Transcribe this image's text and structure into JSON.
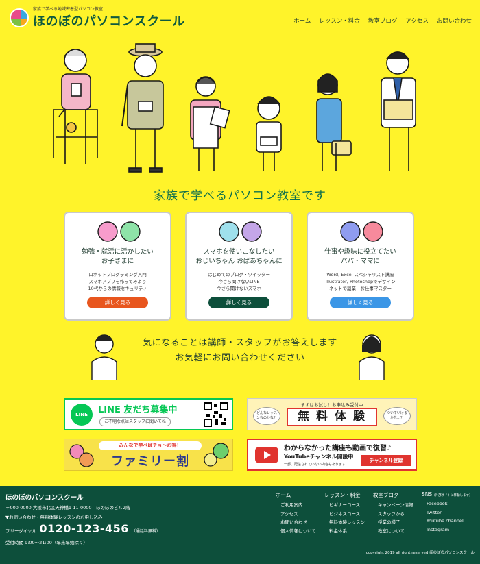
{
  "header": {
    "tagline": "家族で学べる地域密着型パソコン教室",
    "site_name": "ほのぼのパソコンスクール",
    "nav": [
      "ホーム",
      "レッスン・料金",
      "教室ブログ",
      "アクセス",
      "お問い合わせ"
    ]
  },
  "hero": {
    "title": "家族で学べるパソコン教室です"
  },
  "cards": [
    {
      "title1": "勉強・就活に活かしたい",
      "title2": "お子さまに",
      "lines": [
        "ロボットプログラミング入門",
        "スマホアプリを作ってみよう",
        "10代からの情報セキュリティ"
      ],
      "button": "詳しく見る",
      "button_color": "#e8561e"
    },
    {
      "title1": "スマホを使いこなしたい",
      "title2": "おじいちゃん おばあちゃんに",
      "lines": [
        "はじめてのブログ・ツイッター",
        "今さら聞けないLINE",
        "今さら聞けないスマホ"
      ],
      "button": "詳しく見る",
      "button_color": "#0d4f3b"
    },
    {
      "title1": "仕事や趣味に役立てたい",
      "title2": "パパ・ママに",
      "lines": [
        "Word, Excel スペシャリスト講座",
        "Illustrator, Photoshopでデザイン",
        "ネットで副業　お仕事マスター"
      ],
      "button": "詳しく見る",
      "button_color": "#3b96e6"
    }
  ],
  "contact_prompt": {
    "line1": "気になることは講師・スタッフがお答えします",
    "line2": "お気軽にお問い合わせください"
  },
  "banners": {
    "line": {
      "title": "LINE 友だち募集中",
      "sub": "ご不明な点はスタッフに聞いてね",
      "icon_text": "LINE"
    },
    "trial": {
      "title": "無料体験",
      "top": "まずはお試し！お申込み受付中",
      "left_bubble": "どんなレッスンなのかな？",
      "right_bubble": "ついていけるかな…？"
    },
    "family": {
      "top": "みんなで学べばチョ～お得！",
      "title": "ファミリー割"
    },
    "youtube": {
      "title": "わからなかった講座も動画で復習♪",
      "sub": "YouTubeチャンネル開設中",
      "note": "一部、配信されていない内容もあります",
      "button": "チャンネル登録"
    }
  },
  "footer": {
    "name": "ほのぼのパソコンスクール",
    "address": "〒000-0000 大阪市北区天神橋1-11-0000　ほのぼのビル2階",
    "inquiry": "▼お問い合わせ・無料体験レッスンのお申し込み",
    "tel_label": "フリーダイヤル",
    "tel": "0120-123-456",
    "tel_note": "（通話料無料）",
    "hours": "受付時間 9:00～21:00（年末年始除く）",
    "columns": [
      {
        "head": "ホーム",
        "items": [
          "ご利用案内",
          "アクセス",
          "お問い合わせ",
          "個人情報について"
        ]
      },
      {
        "head": "レッスン・料金",
        "items": [
          "ビギナーコース",
          "ビジネスコース",
          "無料体験レッスン",
          "料金体系"
        ]
      },
      {
        "head": "教室ブログ",
        "items": [
          "キャンペーン情報",
          "スタッフから",
          "授業の様子",
          "教室について"
        ]
      },
      {
        "head": "SNS",
        "head_note": "（外部サイトに移動します）",
        "items": [
          "Facebook",
          "Twitter",
          "Youtube channel",
          "Instagram"
        ]
      }
    ],
    "copyright": "copyright 2019 all right reserved ほのぼのパソコンスクール"
  },
  "colors": {
    "background": "#fff32a",
    "brand_green": "#0d4f3b",
    "title_green": "#10704c"
  }
}
